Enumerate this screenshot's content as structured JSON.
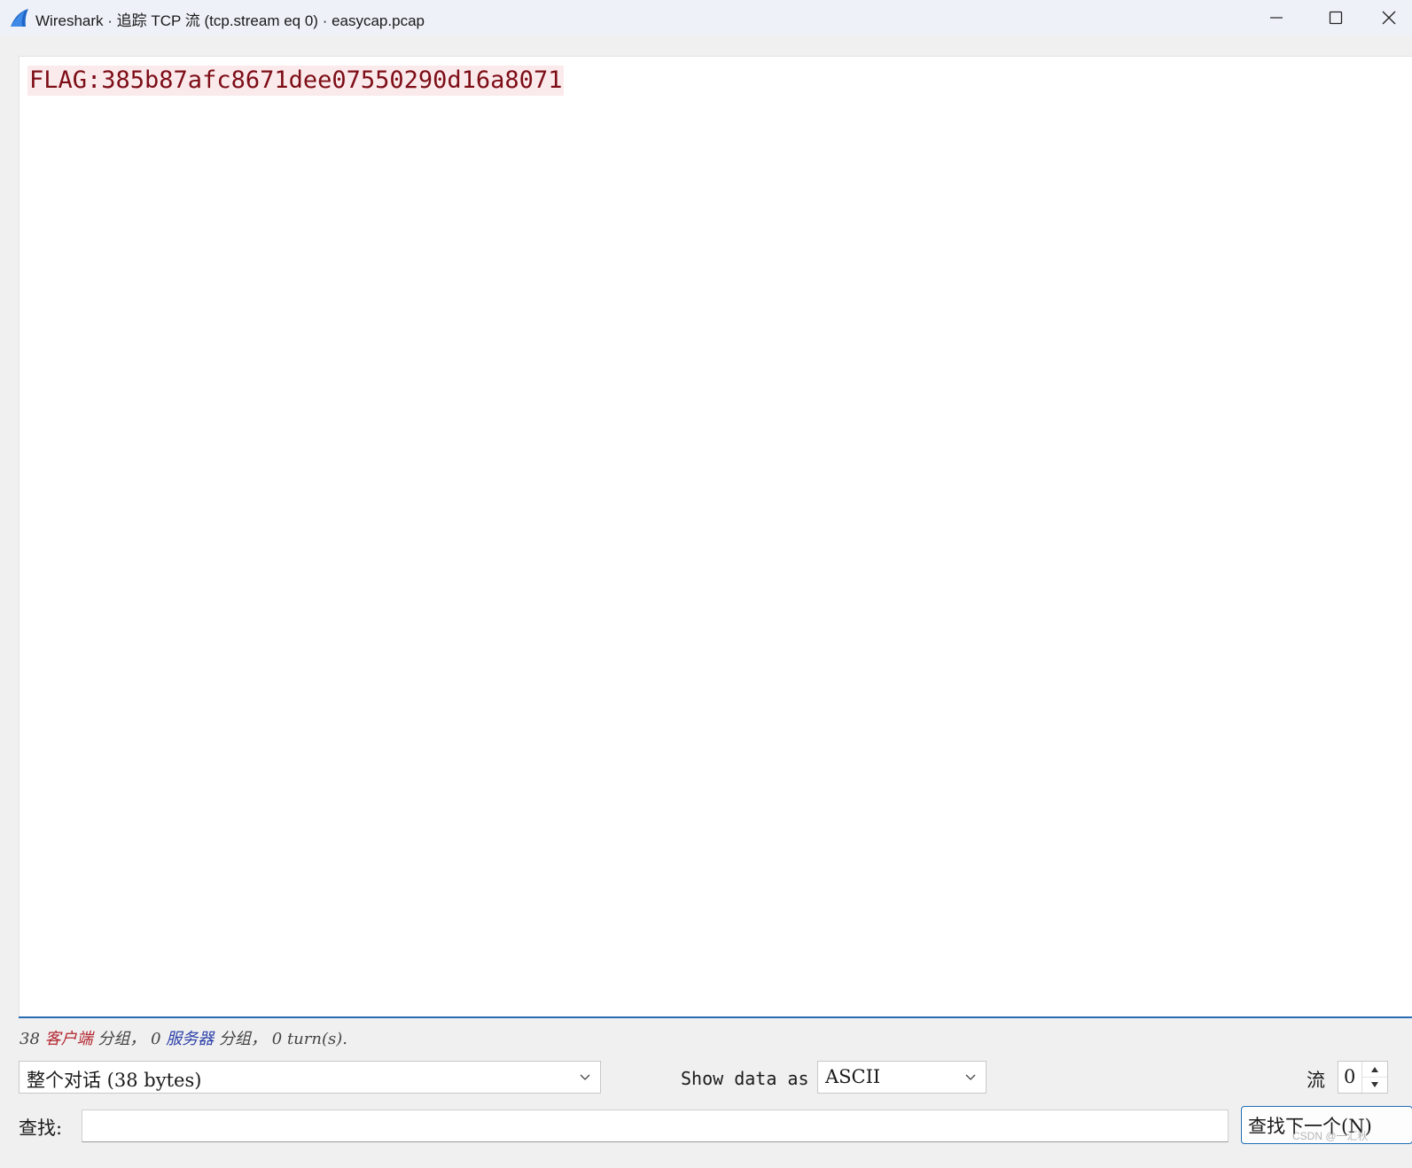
{
  "window": {
    "title": "Wireshark · 追踪 TCP 流 (tcp.stream eq 0) · easycap.pcap",
    "icon": "wireshark-fin-icon",
    "controls": [
      "minimize-icon",
      "maximize-icon",
      "close-icon"
    ]
  },
  "stream": {
    "text": "FLAG:385b87afc8671dee07550290d16a8071",
    "text_color": "#7d0d16",
    "highlight_color": "#fbeaec"
  },
  "status": {
    "client_count": "38",
    "client_label": "客户端",
    "packets_label_1": "分组，",
    "server_count": "0",
    "server_label": "服务器",
    "packets_label_2": "分组，",
    "turns_count": "0",
    "turns_label": "turn(s)."
  },
  "controls": {
    "conversation_value": "整个对话 (38 bytes)",
    "show_data_label": "Show data as",
    "format_value": "ASCII",
    "stream_label": "流",
    "stream_number": "0"
  },
  "find": {
    "label": "查找:",
    "value": "",
    "next_button_label": "查找下一个(N)"
  },
  "watermark": "CSDN @一汇秋",
  "colors": {
    "accent": "#2a6bb5",
    "client": "#b3262f",
    "server": "#2b3fa8"
  }
}
